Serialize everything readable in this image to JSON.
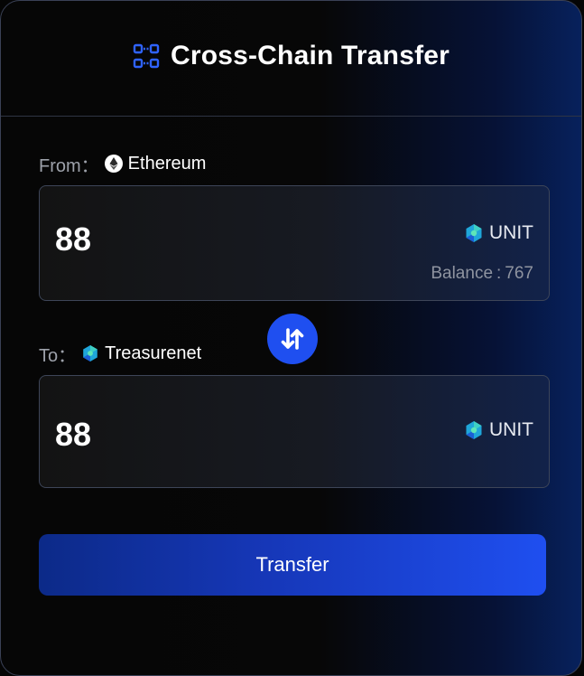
{
  "header": {
    "title": "Cross-Chain Transfer",
    "icon": "bridge-transfer-icon"
  },
  "from": {
    "label": "From：",
    "chain_name": "Ethereum",
    "chain_icon": "ethereum-icon",
    "amount": "88",
    "unit": "UNIT",
    "unit_icon": "unit-token-icon",
    "balance_label": "Balance",
    "balance_sep": ":",
    "balance_value": "767"
  },
  "to": {
    "label": "To：",
    "chain_name": "Treasurenet",
    "chain_icon": "treasurenet-icon",
    "amount": "88",
    "unit": "UNIT",
    "unit_icon": "unit-token-icon"
  },
  "swap": {
    "icon": "swap-arrows-icon"
  },
  "actions": {
    "transfer_label": "Transfer"
  },
  "colors": {
    "accent": "#1f4ff0",
    "text": "#ffffff",
    "muted": "#9da1aa",
    "border": "#3d4558"
  }
}
